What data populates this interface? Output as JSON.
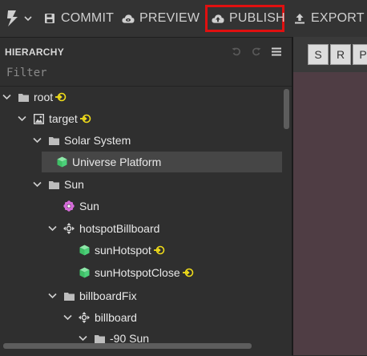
{
  "toolbar": {
    "commit_label": "COMMIT",
    "preview_label": "PREVIEW",
    "publish_label": "PUBLISH",
    "export_label": "EXPORT",
    "highlight_color": "#e01010"
  },
  "hierarchy": {
    "title": "HIERARCHY",
    "filter_placeholder": "Filter",
    "items": [
      {
        "label": "root",
        "icon": "folder-icon",
        "expanded": true,
        "linked": true
      },
      {
        "label": "target",
        "icon": "image-icon",
        "expanded": true,
        "linked": true
      },
      {
        "label": "Solar System",
        "icon": "folder-icon",
        "expanded": true,
        "linked": false
      },
      {
        "label": "Universe Platform",
        "icon": "cube-icon",
        "expanded": false,
        "linked": false,
        "selected": true
      },
      {
        "label": "Sun",
        "icon": "folder-icon",
        "expanded": true,
        "linked": false
      },
      {
        "label": "Sun",
        "icon": "flower-icon",
        "expanded": false,
        "linked": false
      },
      {
        "label": "hotspotBillboard",
        "icon": "transform-icon",
        "expanded": true,
        "linked": false
      },
      {
        "label": "sunHotspot",
        "icon": "cube-icon",
        "expanded": false,
        "linked": true
      },
      {
        "label": "sunHotspotClose",
        "icon": "cube-icon",
        "expanded": false,
        "linked": true
      },
      {
        "label": "billboardFix",
        "icon": "folder-icon",
        "expanded": true,
        "linked": false
      },
      {
        "label": "billboard",
        "icon": "transform-icon",
        "expanded": true,
        "linked": false
      },
      {
        "label": "-90 Sun",
        "icon": "folder-icon",
        "expanded": true,
        "linked": false
      }
    ]
  },
  "view_tabs": [
    "S",
    "R",
    "P"
  ],
  "colors": {
    "cube": "#4cd07a",
    "link": "#f0dc1a",
    "flower": "#d46bd8",
    "viewport": "#4f3d44"
  }
}
